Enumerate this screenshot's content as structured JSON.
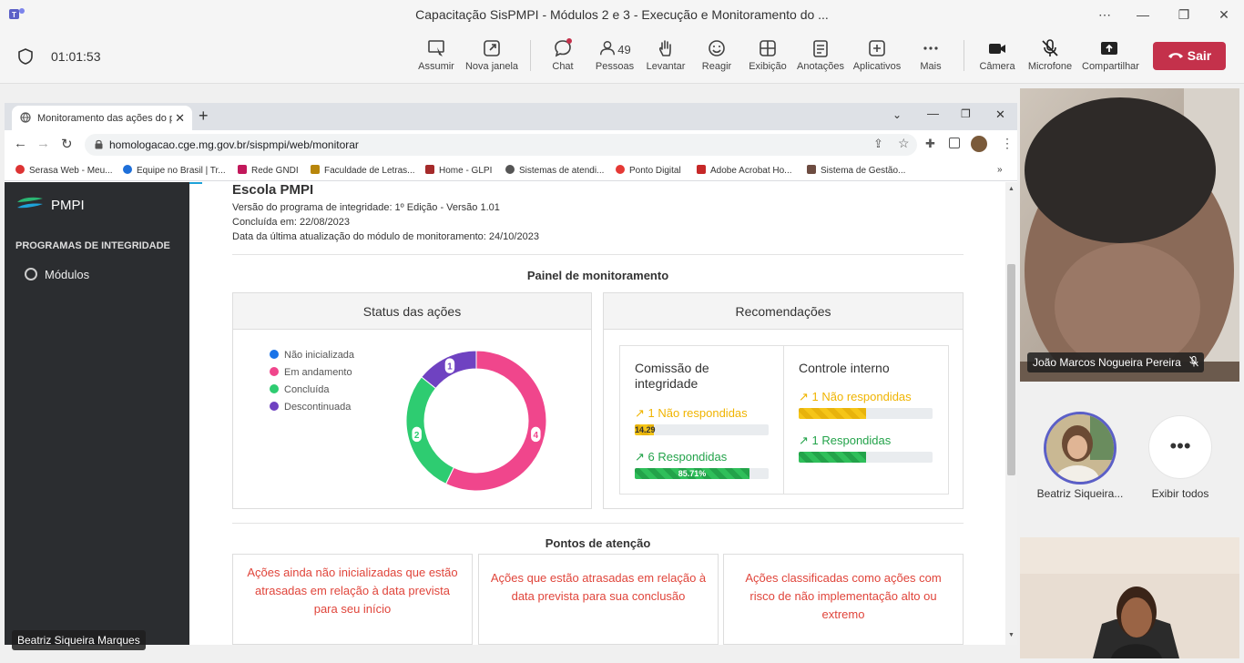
{
  "teams": {
    "window_title": "Capacitação SisPMPI - Módulos 2 e 3 - Execução e Monitoramento do ...",
    "timer": "01:01:53",
    "toolbar": [
      {
        "label": "Assumir",
        "icon": "screen-pointer-icon"
      },
      {
        "label": "Nova janela",
        "icon": "popout-window-icon"
      },
      {
        "label": "Chat",
        "icon": "chat-icon"
      },
      {
        "label": "Pessoas",
        "icon": "people-icon",
        "count": "49"
      },
      {
        "label": "Levantar",
        "icon": "raise-hand-icon"
      },
      {
        "label": "Reagir",
        "icon": "smile-icon"
      },
      {
        "label": "Exibição",
        "icon": "layout-grid-icon"
      },
      {
        "label": "Anotações",
        "icon": "notes-icon"
      },
      {
        "label": "Aplicativos",
        "icon": "add-app-icon"
      },
      {
        "label": "Mais",
        "icon": "more-dots-icon"
      },
      {
        "label": "Câmera",
        "icon": "camera-icon"
      },
      {
        "label": "Microfone",
        "icon": "mic-off-icon"
      },
      {
        "label": "Compartilhar",
        "icon": "share-up-icon"
      }
    ],
    "leave_label": "Sair",
    "presenter_name": "Beatriz Siqueira Marques",
    "video1_name": "João Marcos Nogueira Pereira",
    "participant_tile_name": "Beatriz Siqueira...",
    "show_all_label": "Exibir todos"
  },
  "browser": {
    "tab_title": "Monitoramento das ações do pr",
    "url": "homologacao.cge.mg.gov.br/sispmpi/web/monitorar",
    "bookmarks": [
      "Serasa Web - Meu...",
      "Equipe no Brasil | Tr...",
      "Rede GNDI",
      "Faculdade de Letras...",
      "Home - GLPI",
      "Sistemas de atendi...",
      "Ponto Digital",
      "Adobe Acrobat Ho...",
      "Sistema de Gestão..."
    ]
  },
  "app": {
    "logo_text": "PMPI",
    "section_heading": "PROGRAMAS DE INTEGRIDADE",
    "nav_item": "Módulos",
    "school_name": "Escola PMPI",
    "info_lines": [
      "Versão do programa de integridade: 1º Edição - Versão 1.01",
      "Concluída em: 22/08/2023",
      "Data da última atualização do módulo de monitoramento: 24/10/2023"
    ],
    "panel_title": "Painel de monitoramento",
    "status_card_title": "Status das ações",
    "recommendations_title": "Recomendações",
    "commission": {
      "title": "Comissão de integridade",
      "pending_label": "1 Não respondidas",
      "pending_pct_label": "14.29",
      "pending_pct": 14.29,
      "answered_label": "6 Respondidas",
      "answered_pct_label": "85.71%",
      "answered_pct": 85.71
    },
    "internal_control": {
      "title": "Controle interno",
      "pending_label": "1 Não respondidas",
      "pending_pct": 50,
      "answered_label": "1 Respondidas",
      "answered_pct": 50
    },
    "attention_title": "Pontos de atenção",
    "attention_cards": [
      "Ações ainda não inicializadas que estão atrasadas em relação à data prevista para seu início",
      "Ações que estão atrasadas em relação à data prevista para sua conclusão",
      "Ações classificadas como ações com risco de não implementação alto ou extremo"
    ]
  },
  "chart_data": {
    "type": "pie",
    "categories": [
      "Não inicializada",
      "Em andamento",
      "Concluída",
      "Descontinuada"
    ],
    "values": [
      0,
      4,
      2,
      1
    ],
    "colors": [
      "#1a73e8",
      "#f0468c",
      "#2ecc71",
      "#6f42c1"
    ],
    "legend": "left",
    "donut": true
  }
}
